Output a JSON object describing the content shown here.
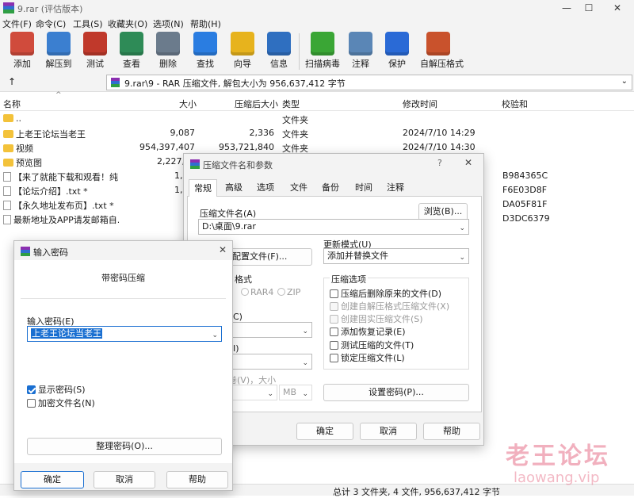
{
  "window": {
    "title": "9.rar (评估版本)"
  },
  "menu": [
    "文件(F)",
    "命令(C)",
    "工具(S)",
    "收藏夹(O)",
    "选项(N)",
    "帮助(H)"
  ],
  "toolbar": [
    {
      "label": "添加",
      "icon": "add-archive-icon",
      "color": "#d04b3c"
    },
    {
      "label": "解压到",
      "icon": "extract-folder-icon",
      "color": "#3b7fd0"
    },
    {
      "label": "测试",
      "icon": "test-clipboard-icon",
      "color": "#c0392b"
    },
    {
      "label": "查看",
      "icon": "view-book-icon",
      "color": "#2e8b57"
    },
    {
      "label": "删除",
      "icon": "trash-icon",
      "color": "#6b7b8c"
    },
    {
      "label": "查找",
      "icon": "magnifier-icon",
      "color": "#2a7de1"
    },
    {
      "label": "向导",
      "icon": "wizard-wand-icon",
      "color": "#e7b31d"
    },
    {
      "label": "信息",
      "icon": "info-icon",
      "color": "#2f6fc0"
    },
    {
      "label": "扫描病毒",
      "icon": "virus-scan-icon",
      "color": "#3aa635"
    },
    {
      "label": "注释",
      "icon": "comment-icon",
      "color": "#5a86b6"
    },
    {
      "label": "保护",
      "icon": "shield-icon",
      "color": "#2a6ad6"
    },
    {
      "label": "自解压格式",
      "icon": "sfx-archive-icon",
      "color": "#c9522c"
    }
  ],
  "address": "9.rar\\9 - RAR 压缩文件, 解包大小为 956,637,412 字节",
  "columns": [
    "名称",
    "大小",
    "压缩后大小",
    "类型",
    "修改时间",
    "校验和"
  ],
  "files": [
    {
      "name": "..",
      "size": "",
      "packed": "",
      "type": "文件夹",
      "modified": "",
      "crc": "",
      "kind": "folder"
    },
    {
      "name": "上老王论坛当老王",
      "size": "9,087",
      "packed": "2,336",
      "type": "文件夹",
      "modified": "2024/7/10 14:29",
      "crc": "",
      "kind": "folder"
    },
    {
      "name": "视频",
      "size": "954,397,407",
      "packed": "953,721,840",
      "type": "文件夹",
      "modified": "2024/7/10 14:30",
      "crc": "",
      "kind": "folder"
    },
    {
      "name": "预览图",
      "size": "2,227,",
      "packed": "",
      "type": "",
      "modified": "",
      "crc": "",
      "kind": "folder"
    },
    {
      "name": "【来了就能下载和观看！纯...",
      "size": "1,",
      "packed": "",
      "type": "",
      "modified": "",
      "crc": "B984365C",
      "kind": "file"
    },
    {
      "name": "【论坛介绍】.txt *",
      "size": "1,",
      "packed": "",
      "type": "",
      "modified": "",
      "crc": "F6E03D8F",
      "kind": "file"
    },
    {
      "name": "【永久地址发布页】.txt *",
      "size": "",
      "packed": "",
      "type": "",
      "modified": "",
      "crc": "DA05F81F",
      "kind": "file"
    },
    {
      "name": "最新地址及APP请发邮箱自...",
      "size": "",
      "packed": "",
      "type": "",
      "modified": "",
      "crc": "D3DC6379",
      "kind": "file"
    }
  ],
  "status": "总计 3 文件夹, 4 文件, 956,637,412 字节",
  "archive_dialog": {
    "title": "压缩文件名和参数",
    "help": "?",
    "tabs": [
      "常规",
      "高级",
      "选项",
      "文件",
      "备份",
      "时间",
      "注释"
    ],
    "filename_label": "压缩文件名(A)",
    "filename_value": "D:\\桌面\\9.rar",
    "browse": "浏览(B)...",
    "profile_btn": "配置文件(F)...",
    "update_label": "更新模式(U)",
    "update_value": "添加并替换文件",
    "format_label": "格式",
    "format_rar4": "RAR4",
    "format_zip": "ZIP",
    "method_label": "C)",
    "dict_label": "I)",
    "volume_label": "卷(V)，大小",
    "volume_unit": "MB",
    "options_title": "压缩选项",
    "options": [
      {
        "label": "压缩后删除原来的文件(D)",
        "checked": false,
        "disabled": false
      },
      {
        "label": "创建自解压格式压缩文件(X)",
        "checked": false,
        "disabled": true
      },
      {
        "label": "创建固实压缩文件(S)",
        "checked": false,
        "disabled": true
      },
      {
        "label": "添加恢复记录(E)",
        "checked": false,
        "disabled": false
      },
      {
        "label": "测试压缩的文件(T)",
        "checked": false,
        "disabled": false
      },
      {
        "label": "锁定压缩文件(L)",
        "checked": false,
        "disabled": false
      }
    ],
    "set_password": "设置密码(P)...",
    "ok": "确定",
    "cancel": "取消",
    "help_btn": "帮助"
  },
  "password_dialog": {
    "title": "输入密码",
    "heading": "带密码压缩",
    "input_label": "输入密码(E)",
    "input_value": "上老王论坛当老王",
    "show_password": "显示密码(S)",
    "encrypt_names": "加密文件名(N)",
    "organize": "整理密码(O)...",
    "ok": "确定",
    "cancel": "取消",
    "help": "帮助"
  },
  "watermark": {
    "brand": "老王论坛",
    "url": "laowang.vip",
    "color": "#e0506e"
  }
}
